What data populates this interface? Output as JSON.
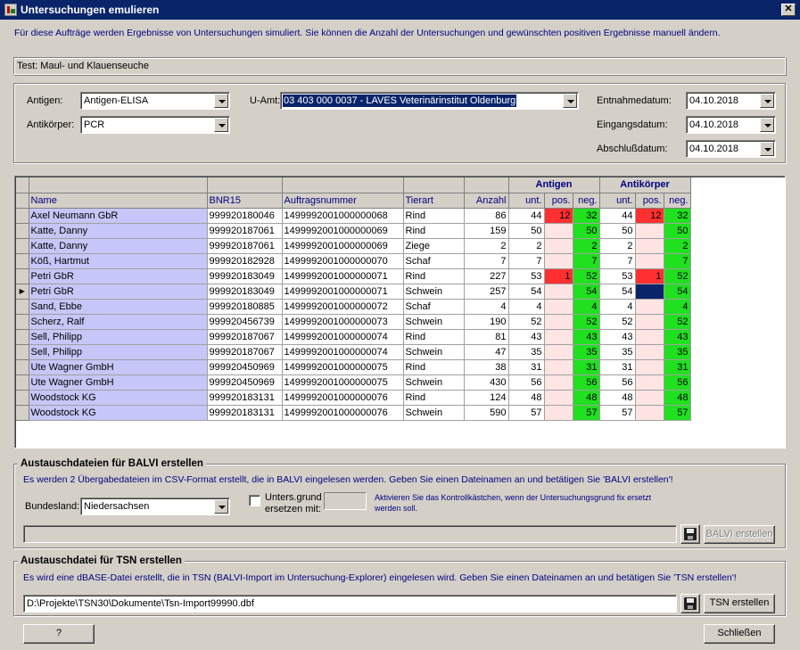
{
  "window": {
    "title": "Untersuchungen emulieren",
    "close_label": "✕"
  },
  "intro": "Für diese Aufträge werden Ergebnisse von Untersuchungen simuliert. Sie können die Anzahl der Untersuchungen und gewünschten positiven Ergebnisse manuell ändern.",
  "test_label": "Test: Maul- und Klauenseuche",
  "filters": {
    "antigen_label": "Antigen:",
    "antigen_value": "Antigen-ELISA",
    "antikoerper_label": "Antikörper:",
    "antikoerper_value": "PCR",
    "uamt_label": "U-Amt:",
    "uamt_value": "03 403 000 0037 - LAVES Veterinärinstitut Oldenburg",
    "entnahme_label": "Entnahmedatum:",
    "entnahme_value": "04.10.2018",
    "eingang_label": "Eingangsdatum:",
    "eingang_value": "04.10.2018",
    "abschluss_label": "Abschlußdatum:",
    "abschluss_value": "04.10.2018"
  },
  "grid": {
    "group_headers": {
      "antigen": "Antigen",
      "antikoerper": "Antikörper"
    },
    "columns": [
      "Name",
      "BNR15",
      "Auftragsnummer",
      "Tierart",
      "Anzahl",
      "unt.",
      "pos.",
      "neg.",
      "unt.",
      "pos.",
      "neg."
    ],
    "current_row_marker": "▶",
    "rows": [
      {
        "name": "Axel Neumann GbR",
        "bnr": "999920180046",
        "auftrag": "1499992001000000068",
        "tierart": "Rind",
        "anzahl": "86",
        "ag_unt": "44",
        "ag_pos": "12",
        "ag_neg": "32",
        "ak_unt": "44",
        "ak_pos": "12",
        "ak_neg": "32"
      },
      {
        "name": "Katte, Danny",
        "bnr": "999920187061",
        "auftrag": "1499992001000000069",
        "tierart": "Rind",
        "anzahl": "159",
        "ag_unt": "50",
        "ag_pos": "",
        "ag_neg": "50",
        "ak_unt": "50",
        "ak_pos": "",
        "ak_neg": "50"
      },
      {
        "name": "Katte, Danny",
        "bnr": "999920187061",
        "auftrag": "1499992001000000069",
        "tierart": "Ziege",
        "anzahl": "2",
        "ag_unt": "2",
        "ag_pos": "",
        "ag_neg": "2",
        "ak_unt": "2",
        "ak_pos": "",
        "ak_neg": "2"
      },
      {
        "name": "Köß, Hartmut",
        "bnr": "999920182928",
        "auftrag": "1499992001000000070",
        "tierart": "Schaf",
        "anzahl": "7",
        "ag_unt": "7",
        "ag_pos": "",
        "ag_neg": "7",
        "ak_unt": "7",
        "ak_pos": "",
        "ak_neg": "7"
      },
      {
        "name": "Petri GbR",
        "bnr": "999920183049",
        "auftrag": "1499992001000000071",
        "tierart": "Rind",
        "anzahl": "227",
        "ag_unt": "53",
        "ag_pos": "1",
        "ag_neg": "52",
        "ak_unt": "53",
        "ak_pos": "1",
        "ak_neg": "52"
      },
      {
        "name": "Petri GbR",
        "bnr": "999920183049",
        "auftrag": "1499992001000000071",
        "tierart": "Schwein",
        "anzahl": "257",
        "ag_unt": "54",
        "ag_pos": "",
        "ag_neg": "54",
        "ak_unt": "54",
        "ak_pos": "",
        "ak_neg": "54"
      },
      {
        "name": "Sand, Ebbe",
        "bnr": "999920180885",
        "auftrag": "1499992001000000072",
        "tierart": "Schaf",
        "anzahl": "4",
        "ag_unt": "4",
        "ag_pos": "",
        "ag_neg": "4",
        "ak_unt": "4",
        "ak_pos": "",
        "ak_neg": "4"
      },
      {
        "name": "Scherz, Ralf",
        "bnr": "999920456739",
        "auftrag": "1499992001000000073",
        "tierart": "Schwein",
        "anzahl": "190",
        "ag_unt": "52",
        "ag_pos": "",
        "ag_neg": "52",
        "ak_unt": "52",
        "ak_pos": "",
        "ak_neg": "52"
      },
      {
        "name": "Sell, Philipp",
        "bnr": "999920187067",
        "auftrag": "1499992001000000074",
        "tierart": "Rind",
        "anzahl": "81",
        "ag_unt": "43",
        "ag_pos": "",
        "ag_neg": "43",
        "ak_unt": "43",
        "ak_pos": "",
        "ak_neg": "43"
      },
      {
        "name": "Sell, Philipp",
        "bnr": "999920187067",
        "auftrag": "1499992001000000074",
        "tierart": "Schwein",
        "anzahl": "47",
        "ag_unt": "35",
        "ag_pos": "",
        "ag_neg": "35",
        "ak_unt": "35",
        "ak_pos": "",
        "ak_neg": "35"
      },
      {
        "name": "Ute Wagner GmbH",
        "bnr": "999920450969",
        "auftrag": "1499992001000000075",
        "tierart": "Rind",
        "anzahl": "38",
        "ag_unt": "31",
        "ag_pos": "",
        "ag_neg": "31",
        "ak_unt": "31",
        "ak_pos": "",
        "ak_neg": "31"
      },
      {
        "name": "Ute Wagner GmbH",
        "bnr": "999920450969",
        "auftrag": "1499992001000000075",
        "tierart": "Schwein",
        "anzahl": "430",
        "ag_unt": "56",
        "ag_pos": "",
        "ag_neg": "56",
        "ak_unt": "56",
        "ak_pos": "",
        "ak_neg": "56"
      },
      {
        "name": "Woodstock KG",
        "bnr": "999920183131",
        "auftrag": "1499992001000000076",
        "tierart": "Rind",
        "anzahl": "124",
        "ag_unt": "48",
        "ag_pos": "",
        "ag_neg": "48",
        "ak_unt": "48",
        "ak_pos": "",
        "ak_neg": "48"
      },
      {
        "name": "Woodstock KG",
        "bnr": "999920183131",
        "auftrag": "1499992001000000076",
        "tierart": "Schwein",
        "anzahl": "590",
        "ag_unt": "57",
        "ag_pos": "",
        "ag_neg": "57",
        "ak_unt": "57",
        "ak_pos": "",
        "ak_neg": "57"
      }
    ]
  },
  "balvi": {
    "title": "Austauschdateien für BALVI erstellen",
    "info": "Es werden 2 Übergabedateien im CSV-Format erstellt, die in BALVI eingelesen werden. Geben Sie einen Dateinamen an und betätigen Sie 'BALVI erstellen'!",
    "bundesland_label": "Bundesland:",
    "bundesland_value": "Niedersachsen",
    "checkbox_label_1": "Unters.grund",
    "checkbox_label_2": "ersetzen mit:",
    "hint_1": "Aktivieren Sie das Kontrollkästchen, wenn der Untersuchungsgrund fix ersetzt",
    "hint_2": "werden soll.",
    "file_value": "",
    "button_label": "BALVI erstellen"
  },
  "tsn": {
    "title": "Austauschdatei für TSN erstellen",
    "info": "Es wird eine dBASE-Datei erstellt, die in TSN (BALVI-Import im Untersuchung-Explorer) eingelesen wird. Geben Sie einen Dateinamen an und betätigen Sie 'TSN erstellen'!",
    "file_value": "D:\\Projekte\\TSN30\\Dokumente\\Tsn-Import99990.dbf",
    "button_label": "TSN erstellen"
  },
  "footer": {
    "help_label": "?",
    "close_label": "Schließen"
  }
}
